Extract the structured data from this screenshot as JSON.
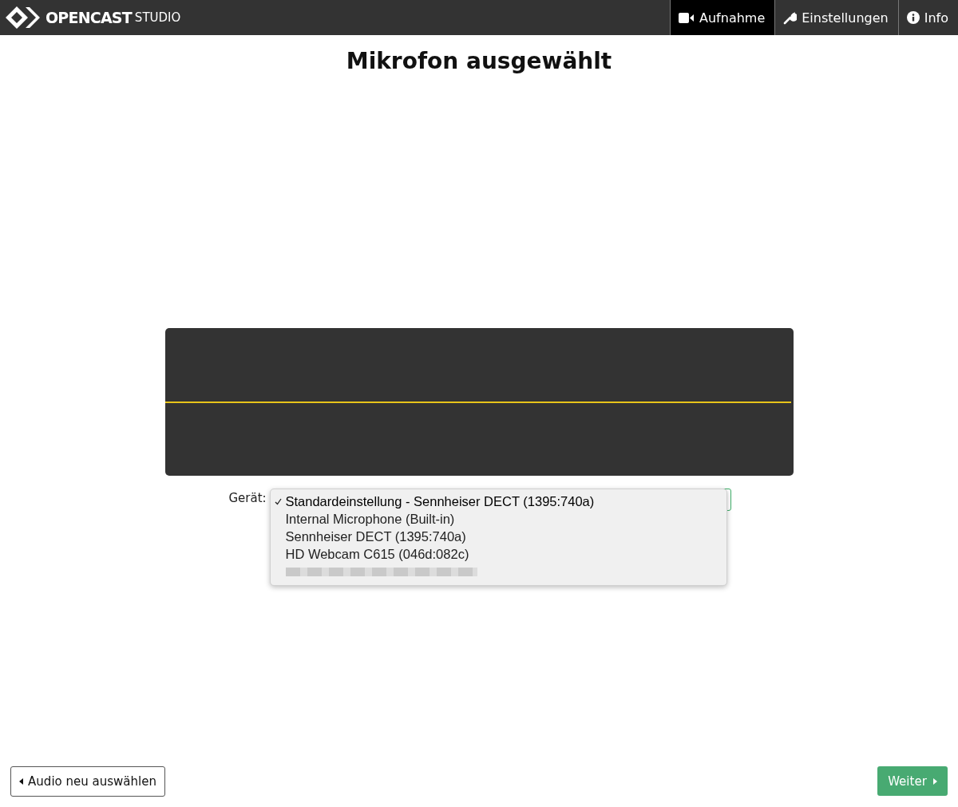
{
  "header": {
    "logo": "OPENCAST",
    "logo_suffix": "STUDIO",
    "tabs": [
      {
        "label": "Aufnahme",
        "selected": true
      },
      {
        "label": "Einstellungen",
        "selected": false
      },
      {
        "label": "Info",
        "selected": false
      }
    ]
  },
  "title": "Mikrofon ausgewählt",
  "device": {
    "label": "Gerät:",
    "options": [
      {
        "kind": "option",
        "label": "Standardeinstellung - Sennheiser DECT (1395:740a)",
        "selected": true
      },
      {
        "kind": "option",
        "label": "Internal Microphone (Built-in)",
        "selected": false
      },
      {
        "kind": "option",
        "label": "Sennheiser DECT (1395:740a)",
        "selected": false
      },
      {
        "kind": "option",
        "label": "HD Webcam C615 (046d:082c)",
        "selected": false
      },
      {
        "kind": "redacted",
        "selected": false
      }
    ]
  },
  "buttons": {
    "back": "Audio neu auswählen",
    "next": "Weiter"
  }
}
